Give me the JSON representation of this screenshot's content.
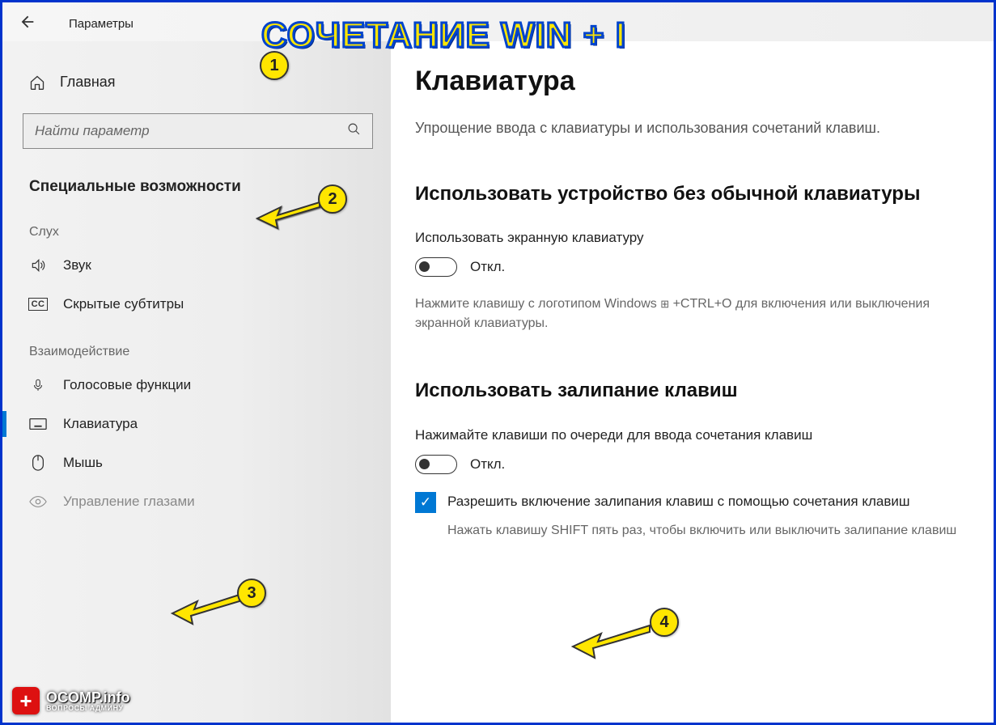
{
  "titlebar": {
    "app_title": "Параметры"
  },
  "sidebar": {
    "home_label": "Главная",
    "search_placeholder": "Найти параметр",
    "section_title": "Специальные возможности",
    "group_hearing": "Слух",
    "group_interaction": "Взаимодействие",
    "items": {
      "sound": "Звук",
      "captions": "Скрытые субтитры",
      "voice": "Голосовые функции",
      "keyboard": "Клавиатура",
      "mouse": "Мышь",
      "eye": "Управление глазами"
    }
  },
  "content": {
    "h1": "Клавиатура",
    "subtitle": "Упрощение ввода с клавиатуры и использования сочетаний клавиш.",
    "sec1_h2": "Использовать устройство без обычной клавиатуры",
    "sec1_opt": "Использовать экранную клавиатуру",
    "sec1_state": "Откл.",
    "sec1_hint_pre": "Нажмите клавишу с логотипом Windows ",
    "sec1_hint_post": " +CTRL+O для включения или выключения экранной клавиатуры.",
    "sec2_h2": "Использовать залипание клавиш",
    "sec2_opt": "Нажимайте клавиши по очереди для ввода сочетания клавиш",
    "sec2_state": "Откл.",
    "sec2_cb_label": "Разрешить включение залипания клавиш с помощью сочетания клавиш",
    "sec2_hint": "Нажать клавишу SHIFT пять раз, чтобы включить или выключить залипание клавиш"
  },
  "annotations": {
    "title": "СОЧЕТАНИЕ WIN + I",
    "badges": {
      "b1": "1",
      "b2": "2",
      "b3": "3",
      "b4": "4"
    },
    "watermark_main": "OCOMP.info",
    "watermark_sub": "ВОПРОСЫ АДМИНУ"
  }
}
